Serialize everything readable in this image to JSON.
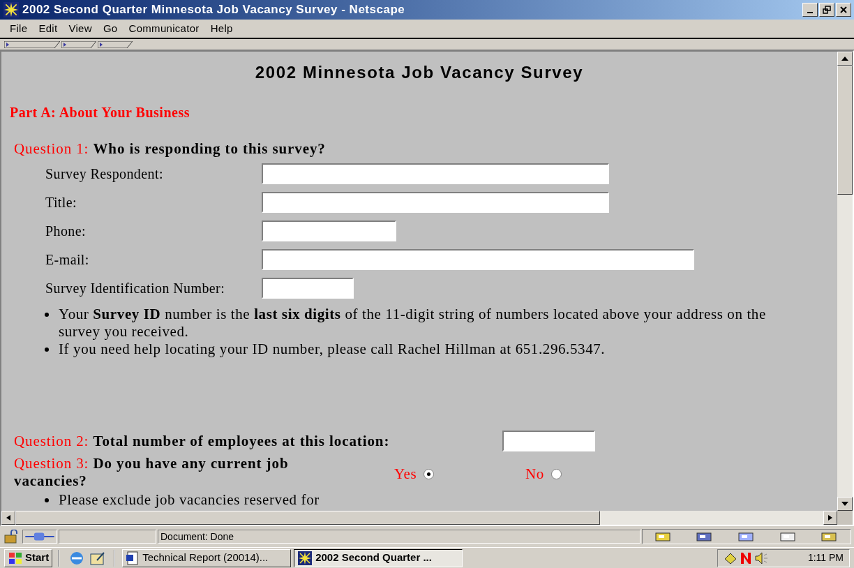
{
  "window": {
    "title": "2002 Second Quarter Minnesota Job Vacancy Survey - Netscape"
  },
  "menu": [
    "File",
    "Edit",
    "View",
    "Go",
    "Communicator",
    "Help"
  ],
  "page": {
    "heading": "2002 Minnesota Job Vacancy Survey",
    "part": "Part A: About Your Business",
    "questions": [
      {
        "kind": "fields",
        "number": "Question 1:",
        "text": "Who is responding to this survey?",
        "fields": [
          {
            "label": "Survey Respondent:",
            "kind": "long"
          },
          {
            "label": "Title:",
            "kind": "long"
          },
          {
            "label": "Phone:",
            "kind": "medium"
          },
          {
            "label": "E-mail:",
            "kind": "wide"
          },
          {
            "label": "Survey Identification Number:",
            "kind": "short"
          }
        ],
        "notes": [
          "Your **Survey ID** number is the **last six digits** of the 11-digit string of numbers located above your address on the survey you received.",
          "If you need help locating your ID number, please call Rachel Hillman at 651.296.5347."
        ]
      },
      {
        "kind": "input",
        "number": "Question 2:",
        "text": "Total number of employees at this location:"
      },
      {
        "kind": "radio",
        "number": "Question 3:",
        "text": "Do you have any current job vacancies?",
        "options": [
          {
            "label": "Yes",
            "selected": true
          },
          {
            "label": "No",
            "selected": false
          }
        ],
        "notes": [
          "Please exclude job vacancies reserved for"
        ]
      }
    ]
  },
  "status_bar": {
    "text": "Document: Done"
  },
  "taskbar": {
    "start": "Start",
    "tasks": [
      {
        "label": "Technical Report (20014)...",
        "selected": false
      },
      {
        "label": "2002 Second Quarter ...",
        "selected": true
      }
    ],
    "clock": "1:11 PM"
  }
}
